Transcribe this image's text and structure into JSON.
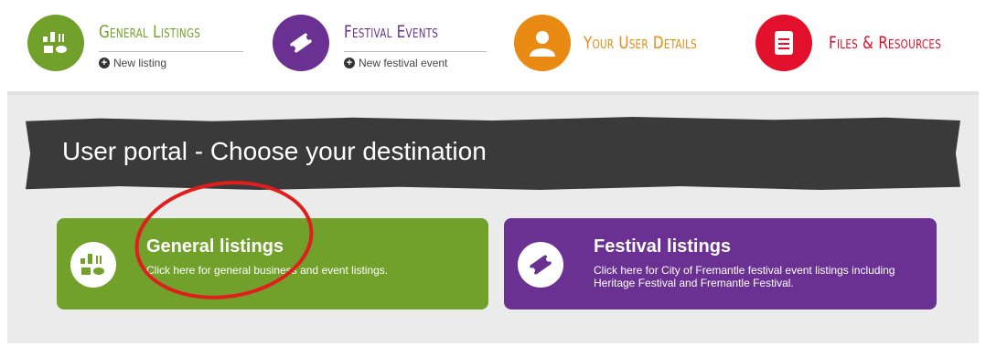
{
  "nav": {
    "items": [
      {
        "title": "General Listings",
        "sub": "New listing",
        "color": "#71a12b",
        "title_color": "#71a12b",
        "icon": "listings-icon"
      },
      {
        "title": "Festival Events",
        "sub": "New festival event",
        "color": "#6a3193",
        "title_color": "#6a3193",
        "icon": "ticket-icon"
      },
      {
        "title": "Your User Details",
        "sub": "",
        "color": "#e98a12",
        "title_color": "#e98a12",
        "icon": "user-icon"
      },
      {
        "title": "Files & Resources",
        "sub": "",
        "color": "#e2102a",
        "title_color": "#e2102a",
        "icon": "document-icon"
      }
    ]
  },
  "portal": {
    "title": "User portal - Choose your destination",
    "cards": [
      {
        "title": "General listings",
        "desc": "Click here for general business and event listings.",
        "color": "#71a12b"
      },
      {
        "title": "Festival listings",
        "desc": "Click here for City of Fremantle festival event listings including Heritage Festival and Fremantle Festival.",
        "color": "#6a3193"
      }
    ]
  }
}
